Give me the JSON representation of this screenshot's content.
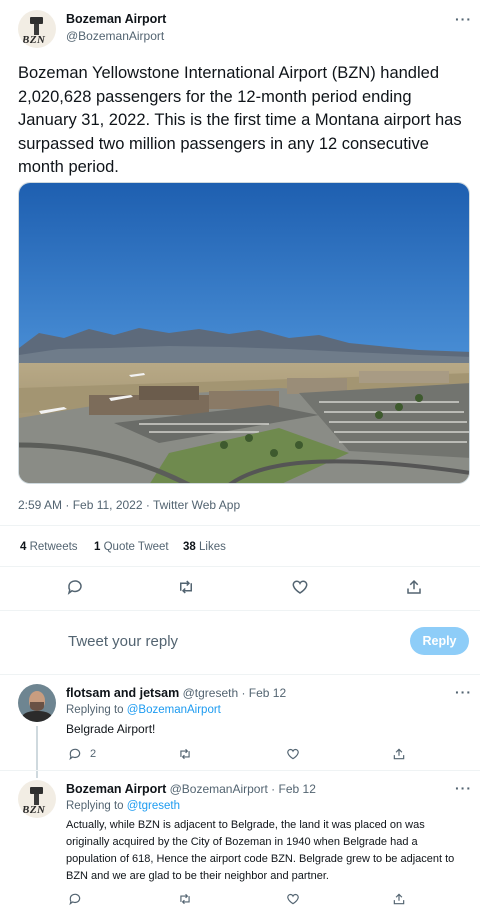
{
  "main_tweet": {
    "author_name": "Bozeman Airport",
    "author_handle": "@BozemanAirport",
    "avatar_text": "BZN",
    "text": "Bozeman Yellowstone International Airport (BZN) handled 2,020,628 passengers for the 12-month period ending January 31, 2022. This is the first time a Montana airport has surpassed two million passengers in any 12 consecutive month period.",
    "timestamp": "2:59 AM · Feb 11, 2022 · Twitter Web App",
    "stats": {
      "retweets_count": "4",
      "retweets_label": "Retweets",
      "quotes_count": "1",
      "quotes_label": "Quote Tweet",
      "likes_count": "38",
      "likes_label": "Likes"
    }
  },
  "reply_composer": {
    "placeholder": "Tweet your reply",
    "button_label": "Reply"
  },
  "replies": [
    {
      "author_name": "flotsam and jetsam",
      "author_handle": "@tgreseth",
      "date": "· Feb 12",
      "replying_to_label": "Replying to",
      "replying_to_handle": "@BozemanAirport",
      "text": "Belgrade Airport!",
      "reply_count": "2"
    },
    {
      "author_name": "Bozeman Airport",
      "author_handle": "@BozemanAirport",
      "date": "· Feb 12",
      "avatar_text": "BZN",
      "replying_to_label": "Replying to",
      "replying_to_handle": "@tgreseth",
      "text": "Actually, while BZN is adjacent to Belgrade, the land it was placed on was originally acquired by the City of Bozeman in 1940 when Belgrade had a population of 618, Hence the airport code BZN. Belgrade grew to be adjacent to BZN and we are glad to be their neighbor and partner."
    }
  ],
  "colors": {
    "accent": "#1d9bf0",
    "reply_button_disabled": "#8ecdf8",
    "muted_text": "#536471"
  },
  "icons": [
    "more-icon",
    "reply-icon",
    "retweet-icon",
    "like-icon",
    "share-icon"
  ]
}
